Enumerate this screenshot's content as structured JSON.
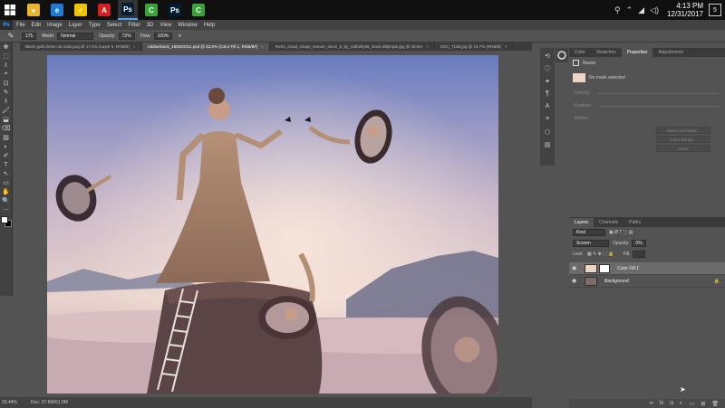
{
  "taskbar": {
    "apps": [
      {
        "name": "chrome",
        "glyph": "●",
        "color": "#e8b52c"
      },
      {
        "name": "edge",
        "glyph": "e",
        "color": "#1f7ad8"
      },
      {
        "name": "norton",
        "glyph": "✓",
        "color": "#f2c200"
      },
      {
        "name": "acrobat",
        "glyph": "A",
        "color": "#d32020"
      },
      {
        "name": "photoshop-1",
        "glyph": "Ps",
        "color": "#001e36"
      },
      {
        "name": "camtasia-1",
        "glyph": "C",
        "color": "#3aa33a"
      },
      {
        "name": "photoshop-2",
        "glyph": "Ps",
        "color": "#001e36"
      },
      {
        "name": "camtasia-2",
        "glyph": "C",
        "color": "#3aa33a"
      }
    ],
    "time": "4:13 PM",
    "date": "12/31/2017",
    "notif_count": "5"
  },
  "menubar": {
    "logo": "Ps",
    "items": [
      "File",
      "Edit",
      "Image",
      "Layer",
      "Type",
      "Select",
      "Filter",
      "3D",
      "View",
      "Window",
      "Help"
    ]
  },
  "optbar": {
    "brush_size": "175",
    "mode_label": "Mode:",
    "mode_value": "Normal",
    "opacity_label": "Opacity:",
    "opacity_value": "72%",
    "flow_label": "Flow:",
    "flow_value": "100%"
  },
  "doctabs": [
    {
      "label": "Blush gold dress cat suits.png @ 17.2% (Layer 0, RGB/8)",
      "active": false
    },
    {
      "label": "AdobeStock_165251011.psd @ 33.3% (Color Fill 1, RGB/8#)",
      "active": true
    },
    {
      "label": "Retro_cloud_shape_texture_stock_5_by_redbelly65_stock-d5ljmjwk.jpg @ 28.6%",
      "active": false
    },
    {
      "label": "DSC_7138.jpg @ 16.7% (RGB/8)",
      "active": false
    }
  ],
  "status": {
    "zoom": "33.44%",
    "doc": "Doc: 27.6M/61.9M"
  },
  "properties": {
    "tabs": [
      {
        "label": "Color",
        "active": false
      },
      {
        "label": "Swatches",
        "active": false
      },
      {
        "label": "Properties",
        "active": true
      },
      {
        "label": "Adjustments",
        "active": false
      }
    ],
    "section": "Masks",
    "no_mask": "No mask selected",
    "density_label": "Density:",
    "feather_label": "Feather:",
    "refine_label": "Refine:",
    "select_mask_btn": "Select and Mask...",
    "color_range_btn": "Color Range...",
    "invert_btn": "Invert"
  },
  "layers_panel": {
    "tabs": [
      {
        "label": "Layers",
        "active": true
      },
      {
        "label": "Channels",
        "active": false
      },
      {
        "label": "Paths",
        "active": false
      }
    ],
    "kind_label": "Kind",
    "blend_mode": "Screen",
    "opacity_label": "Opacity:",
    "opacity_value": "0%",
    "lock_label": "Lock:",
    "fill_label": "Fill:",
    "fill_value": "",
    "layers": [
      {
        "name": "Color Fill 1",
        "selected": true,
        "thumb": "#eed4c5",
        "has_mask": true,
        "locked": false
      },
      {
        "name": "Background",
        "selected": false,
        "thumb": "#7d6c6a",
        "has_mask": false,
        "locked": true
      }
    ]
  },
  "icons": {
    "start": "windows-logo-icon",
    "tool_glyphs": [
      "✥",
      "⬚",
      "ℓ",
      "⌖",
      "⊡",
      "✎",
      "⚕",
      "🖌",
      "⬓",
      "⌫",
      "▨",
      "◐",
      "✐",
      "T",
      "↖",
      "▭",
      "✋",
      "🔍",
      "⋯"
    ]
  }
}
